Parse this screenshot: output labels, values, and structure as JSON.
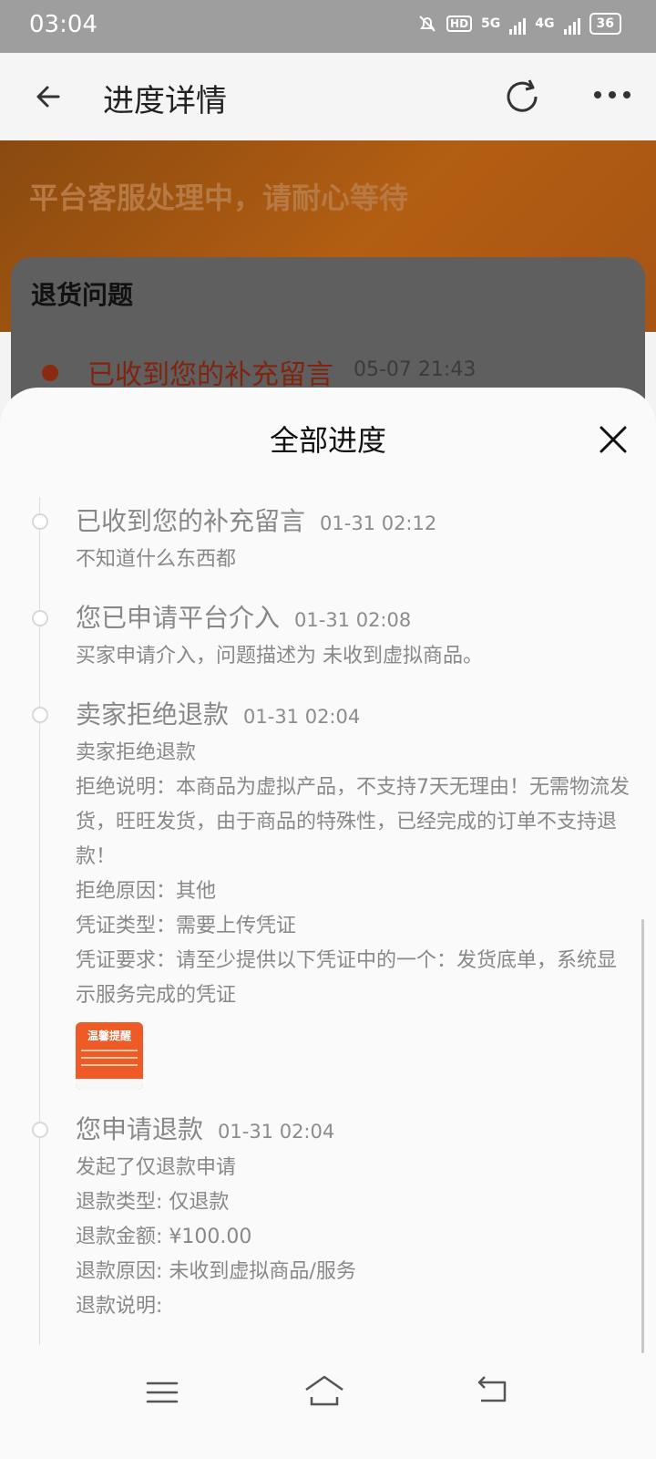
{
  "status": {
    "time": "03:04",
    "battery": "36",
    "net1": "5G",
    "net2": "4G"
  },
  "header": {
    "title": "进度详情"
  },
  "banner": {
    "text": "平台客服处理中，请耐心等待"
  },
  "card": {
    "title": "退货问题",
    "latest_text": "已收到您的补充留言",
    "latest_time": "05-07 21:43"
  },
  "sheet": {
    "title": "全部进度",
    "steps": [
      {
        "title": "已收到您的补充留言",
        "time": "01-31 02:12",
        "lines": [
          "不知道什么东西都"
        ]
      },
      {
        "title": "您已申请平台介入",
        "time": "01-31 02:08",
        "lines": [
          "买家申请介入，问题描述为 未收到虚拟商品。"
        ]
      },
      {
        "title": "卖家拒绝退款",
        "time": "01-31 02:04",
        "lines": [
          "卖家拒绝退款",
          "拒绝说明：本商品为虚拟产品，不支持7天无理由！无需物流发货，旺旺发货，由于商品的特殊性，已经完成的订单不支持退款！",
          "拒绝原因：其他",
          "凭证类型：需要上传凭证",
          "凭证要求：请至少提供以下凭证中的一个：发货底单，系统显示服务完成的凭证"
        ],
        "image_label": "温馨提醒"
      },
      {
        "title": "您申请退款",
        "time": "01-31 02:04",
        "lines": [
          "发起了仅退款申请",
          "退款类型: 仅退款",
          "退款金额: ¥100.00",
          "退款原因: 未收到虚拟商品/服务",
          "退款说明:"
        ]
      }
    ]
  },
  "icons": {
    "back": "back-arrow-icon",
    "refresh": "refresh-icon",
    "more": "more-icon",
    "close": "close-icon"
  }
}
